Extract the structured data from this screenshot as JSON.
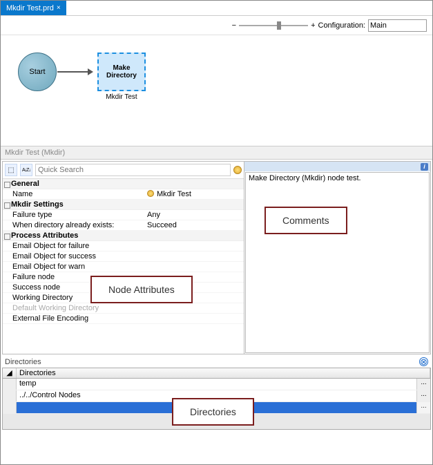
{
  "tab": {
    "title": "Mkdir Test.prd",
    "close": "×"
  },
  "toolbar": {
    "minus": "−",
    "plus": "+",
    "config_label": "Configuration:",
    "config_value": "Main"
  },
  "canvas": {
    "start_label": "Start",
    "mkdir_label_l1": "Make",
    "mkdir_label_l2": "Directory",
    "mkdir_caption": "Mkdir Test"
  },
  "section_title": "Mkdir Test (Mkdir)",
  "attrs": {
    "sort_icon": "⬚",
    "az_icon": "A↓Z↓",
    "search_placeholder": "Quick Search",
    "categories": {
      "general": "General",
      "mkdir": "Mkdir Settings",
      "process": "Process Attributes"
    },
    "rows": {
      "name_k": "Name",
      "name_v": "Mkdir Test",
      "failtype_k": "Failure type",
      "failtype_v": "Any",
      "exists_k": "When directory already exists:",
      "exists_v": "Succeed",
      "emailfail_k": "Email Object for failure",
      "emailfail_v": "",
      "emailsucc_k": "Email Object for success",
      "emailsucc_v": "",
      "emailwarn_k": "Email Object for warn",
      "emailwarn_v": "",
      "failnode_k": "Failure node",
      "failnode_v": "",
      "succnode_k": "Success node",
      "succnode_v": "",
      "workdir_k": "Working Directory",
      "workdir_v": "",
      "defworkdir_k": "Default Working Directory",
      "defworkdir_v": "",
      "extenc_k": "External File Encoding",
      "extenc_v": ""
    }
  },
  "comments": {
    "info_icon": "i",
    "text": "Make Directory (Mkdir) node test."
  },
  "dirs": {
    "title": "Directories",
    "col_header": "Directories",
    "handle": "◢",
    "close": "⊗",
    "browse": "...",
    "rows": [
      "temp",
      "../../Control Nodes",
      ""
    ]
  },
  "callouts": {
    "attrs": "Node Attributes",
    "comments": "Comments",
    "dirs": "Directories"
  }
}
